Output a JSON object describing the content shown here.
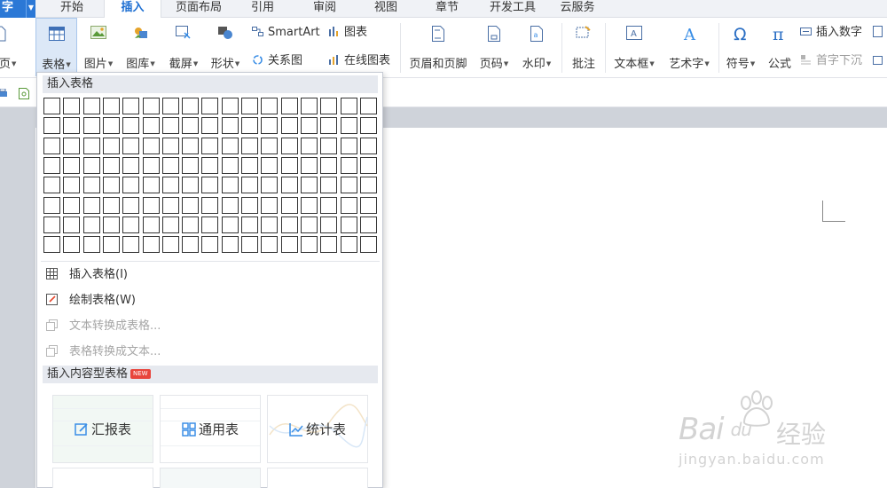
{
  "app": {
    "logo_text": "字"
  },
  "menu_tabs": [
    {
      "label": "开始"
    },
    {
      "label": "插入"
    },
    {
      "label": "页面布局"
    },
    {
      "label": "引用"
    },
    {
      "label": "审阅"
    },
    {
      "label": "视图"
    },
    {
      "label": "章节"
    },
    {
      "label": "开发工具"
    },
    {
      "label": "云服务"
    }
  ],
  "ribbon": {
    "page_label": "页",
    "table_label": "表格",
    "picture_label": "图片",
    "gallery_label": "图库",
    "screenshot_label": "截屏",
    "shape_label": "形状",
    "smartart_label": "SmartArt",
    "chart_label": "图表",
    "relation_label": "关系图",
    "online_chart_label": "在线图表",
    "header_footer_label": "页眉和页脚",
    "page_number_label": "页码",
    "watermark_label": "水印",
    "comment_label": "批注",
    "textbox_label": "文本框",
    "wordart_label": "艺术字",
    "symbol_label": "符号",
    "formula_label": "公式",
    "insert_number_label": "插入数字",
    "dropcap_label": "首字下沉"
  },
  "dropdown": {
    "grid_header": "插入表格",
    "grid_rows": 8,
    "grid_cols": 17,
    "insert_table_label": "插入表格(I)",
    "draw_table_label": "绘制表格(W)",
    "text_to_table_label": "文本转换成表格...",
    "table_to_text_label": "表格转换成文本...",
    "content_header": "插入内容型表格",
    "new_badge": "NEW",
    "cards": [
      {
        "label": "汇报表"
      },
      {
        "label": "通用表"
      },
      {
        "label": "统计表"
      }
    ]
  },
  "watermark": {
    "main_text": "Bai",
    "paw_text": "du",
    "cn_text": "经验",
    "url_text": "jingyan.baidu.com"
  },
  "colors": {
    "accent": "#1e6fd2",
    "logo_bg": "#2b78d6",
    "selected_bg": "#dce8f7",
    "card_icon": "#3a8ee6",
    "badge": "#e8453c"
  }
}
